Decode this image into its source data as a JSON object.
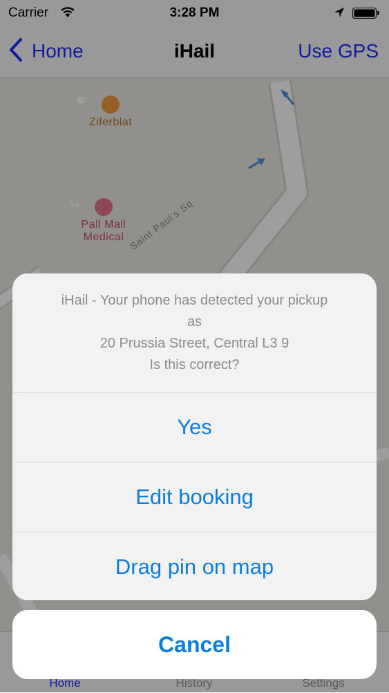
{
  "status_bar": {
    "carrier": "Carrier",
    "time": "3:28 PM",
    "icons": [
      "wifi-icon",
      "location-arrow-icon",
      "battery-icon"
    ]
  },
  "nav": {
    "back_label": "Home",
    "title": "iHail",
    "right_label": "Use GPS",
    "tint_color": "#1a2dff"
  },
  "map": {
    "pois": [
      {
        "name": "Ziferblat",
        "icon": "cafe-icon",
        "color": "#f09a3e"
      },
      {
        "name_line1": "Pall Mall",
        "name_line2": "Medical",
        "icon": "medical-icon",
        "color": "#e57488"
      }
    ],
    "streets": [
      "Saint Paul's Sq"
    ]
  },
  "tabs": [
    {
      "label": "Home",
      "selected": true
    },
    {
      "label": "History",
      "selected": false
    },
    {
      "label": "Settings",
      "selected": false
    }
  ],
  "alert": {
    "message_lines": [
      "iHail - Your phone has detected your pickup",
      "as",
      "20 Prussia Street, Central L3 9",
      "Is this correct?"
    ],
    "actions": [
      "Yes",
      "Edit booking",
      "Drag pin on map"
    ],
    "cancel_label": "Cancel",
    "action_color": "#0a7ee0"
  }
}
